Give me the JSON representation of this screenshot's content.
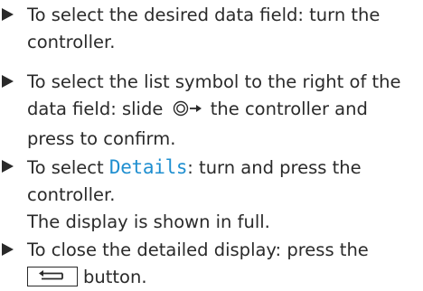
{
  "steps": [
    {
      "line1": "To select the desired data field: turn the",
      "line2": "controller."
    },
    {
      "line1": "To select the list symbol to the right of the",
      "line2_after_icon": "the controller and",
      "line2_before": "data field: slide",
      "line3": "press to confirm."
    },
    {
      "line1_before": "To select",
      "line1_term": "Details",
      "line1_after": ": turn and press the",
      "line2": "controller.",
      "line3": "The display is shown in full."
    },
    {
      "line1": "To close the detailed display: press the",
      "line2": "button."
    }
  ],
  "icons": {
    "bullet": "triangle-right-icon",
    "controller_slide": "controller-slide-right-icon",
    "back_button": "back-arrow-button-icon"
  },
  "colors": {
    "text": "#2a2a2a",
    "menu_term": "#1f8fd0"
  }
}
